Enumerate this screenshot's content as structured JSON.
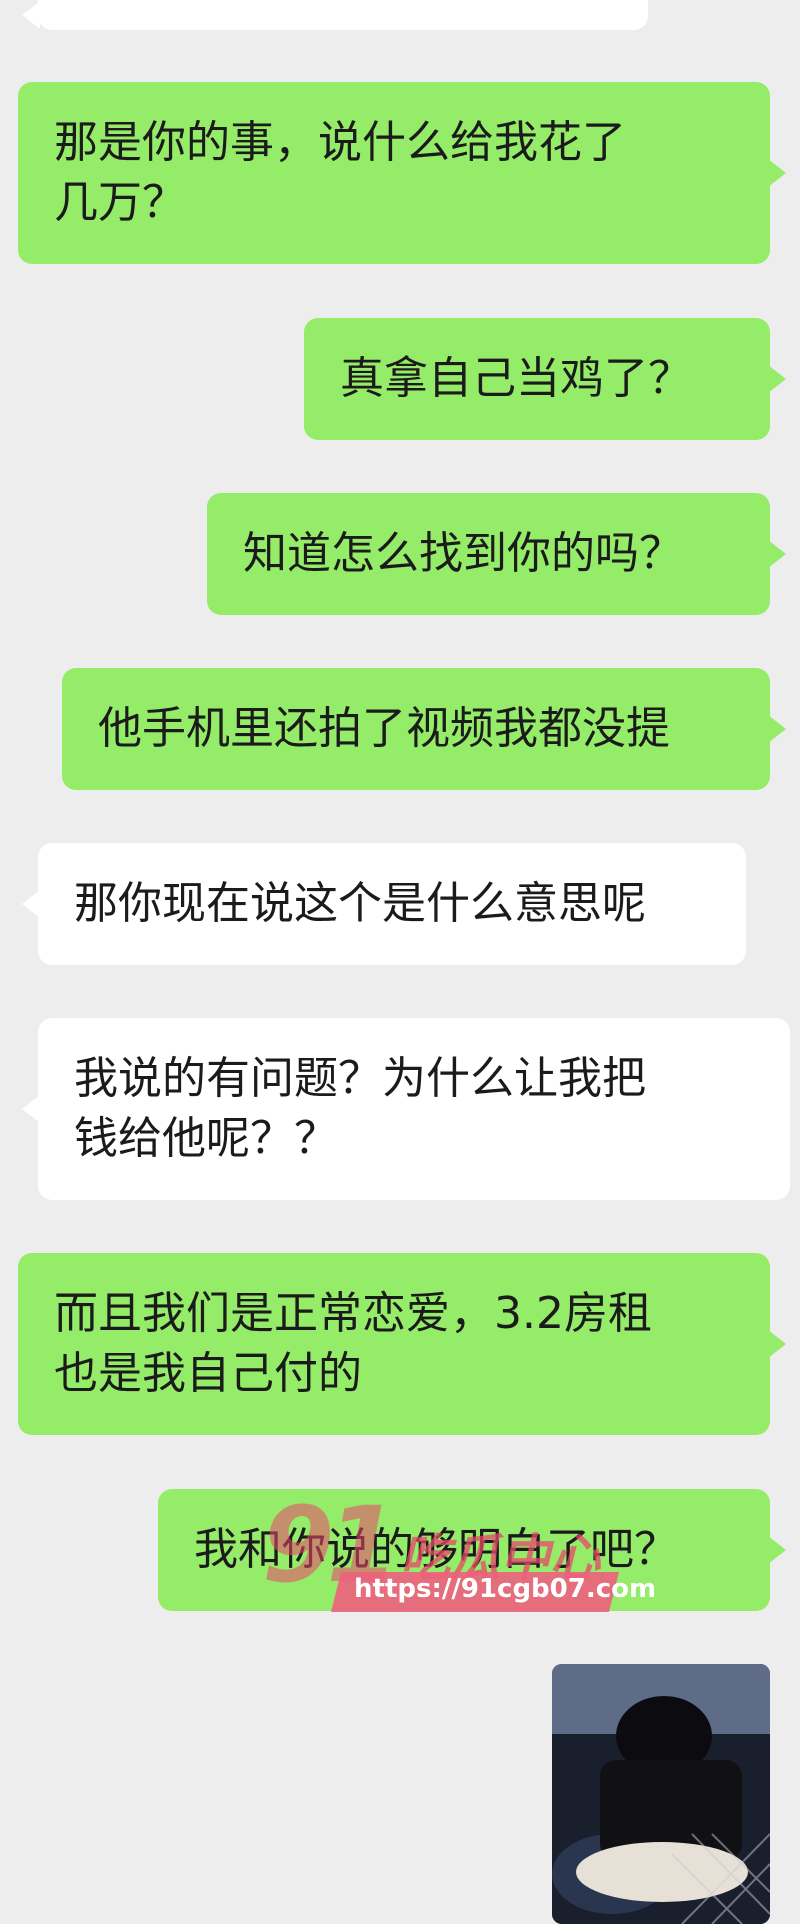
{
  "messages": [
    {
      "side": "recv",
      "lines": [
        ""
      ]
    },
    {
      "side": "sent",
      "lines": [
        "那是你的事，说什么给我花了",
        "几万？"
      ]
    },
    {
      "side": "sent",
      "lines": [
        "真拿自己当鸡了？"
      ]
    },
    {
      "side": "sent",
      "lines": [
        "知道怎么找到你的吗？"
      ]
    },
    {
      "side": "sent",
      "lines": [
        "他手机里还拍了视频我都没提"
      ]
    },
    {
      "side": "recv",
      "lines": [
        "那你现在说这个是什么意思呢"
      ]
    },
    {
      "side": "recv",
      "lines": [
        "我说的有问题？为什么让我把",
        "钱给他呢？？"
      ]
    },
    {
      "side": "sent",
      "lines": [
        "而且我们是正常恋爱，3.2房租",
        "也是我自己付的"
      ]
    },
    {
      "side": "sent",
      "lines": [
        "我和你说的够明白了吧？"
      ]
    }
  ],
  "watermark": {
    "brand_number": "91",
    "brand_text": "吃瓜中心",
    "url": "https://91cgb07.com"
  },
  "colors": {
    "background": "#ededed",
    "sent_bubble": "#95ec69",
    "received_bubble": "#ffffff",
    "watermark": "#ec607e"
  }
}
